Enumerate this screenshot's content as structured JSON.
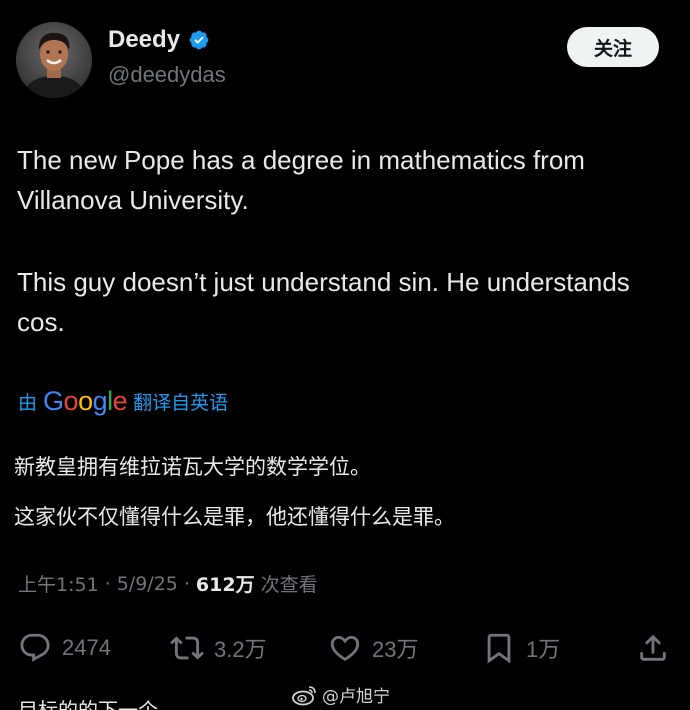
{
  "author": {
    "display_name": "Deedy",
    "handle": "@deedydas",
    "avatar_icon": "avatar-photo",
    "verified_icon": "verified-badge-icon",
    "verified_color": "#1d9bf0"
  },
  "follow_button": {
    "label": "关注"
  },
  "tweet": {
    "paragraph_1": "The new Pope has a degree in mathematics from Villanova University.",
    "paragraph_2": "This guy doesn’t just understand sin. He understands cos."
  },
  "translation": {
    "prefix": "由",
    "provider": "Google",
    "suffix": "翻译自英语",
    "line_1": "新教皇拥有维拉诺瓦大学的数学学位。",
    "line_2": "这家伙不仅懂得什么是罪，他还懂得什么是罪。"
  },
  "meta": {
    "time": "上午1:51",
    "separator_1": "·",
    "date": "5/9/25",
    "separator_2": "·",
    "views_count": "612万",
    "views_label": "次查看"
  },
  "actions": {
    "reply_count": "2474",
    "repost_count": "3.2万",
    "like_count": "23万",
    "bookmark_count": "1万"
  },
  "watermark": {
    "text": "@卢旭宁",
    "icon": "weibo-logo"
  },
  "cut_off_text": "目标的的下一个",
  "colors": {
    "background": "#000000",
    "text_primary": "#e7e9ea",
    "text_secondary": "#71767b",
    "accent": "#1d9bf0"
  }
}
